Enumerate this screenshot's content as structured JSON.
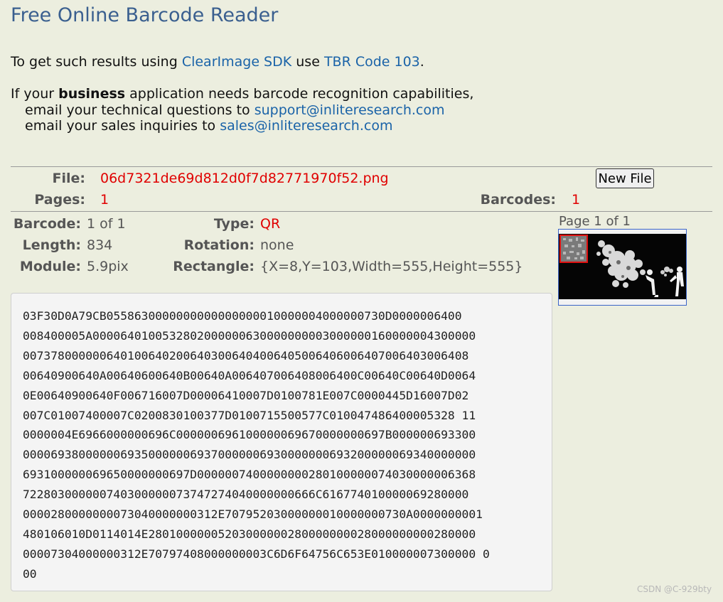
{
  "title": "Free Online Barcode Reader",
  "intro": {
    "prefix": "To get such results using",
    "sdk_link": "ClearImage SDK",
    "middle": "use",
    "code_link": "TBR Code 103",
    "suffix": "."
  },
  "business": {
    "prefix": "If your",
    "bold": "business",
    "suffix": "application needs barcode recognition capabilities,",
    "tech_text": "email your technical questions to",
    "tech_email": "support@inliteresearch.com",
    "sales_text": "email your sales inquiries to",
    "sales_email": "sales@inliteresearch.com"
  },
  "file_info": {
    "file_label": "File:",
    "file_name": "06d7321de69d812d0f7d82771970f52.png",
    "new_file_button": "New File",
    "pages_label": "Pages:",
    "pages_value": "1",
    "barcodes_label": "Barcodes:",
    "barcodes_value": "1"
  },
  "barcode": {
    "barcode_label": "Barcode:",
    "barcode_value": "1 of 1",
    "length_label": "Length:",
    "length_value": "834",
    "module_label": "Module:",
    "module_value": "5.9pix",
    "type_label": "Type:",
    "type_value": "QR",
    "rotation_label": "Rotation:",
    "rotation_value": "none",
    "rectangle_label": "Rectangle:",
    "rectangle_value": "{X=8,Y=103,Width=555,Height=555}"
  },
  "thumbnail": {
    "caption": "Page 1 of 1"
  },
  "data_lines": [
    "03F30D0A79CB0558630000000000000000010000004000000730D0000006400",
    "008400005A0000640100532802000000630000000003000000160000004300000",
    "0073780000006401006402006403006404006405006406006407006403006408",
    "00640900640A00640600640B00640A006407006408006400C00640C00640D0064",
    "0E00640900640F006716007D00006410007D0100781E007C0000445D16007D02",
    "007C01007400007C0200830100377D0100715500577C010047486400005328 11",
    "0000004E6966000000696C000000696100000069670000000697B000000693300",
    "00006938000000693500000069370000006930000000693200000069340000000",
    "693100000069650000000697D0000007400000000280100000074030000006368",
    "722803000000740300000073747274040000000666C616774010000069280000",
    "0000280000000073040000000312E70795203000000010000000730A0000000001",
    "480106010D0114014E28010000005203000000280000000028000000000280000",
    "00007304000000312E70797408000000003C6D6F64756C653E010000007300000 0",
    "00"
  ],
  "watermark": "CSDN @C-929bty"
}
